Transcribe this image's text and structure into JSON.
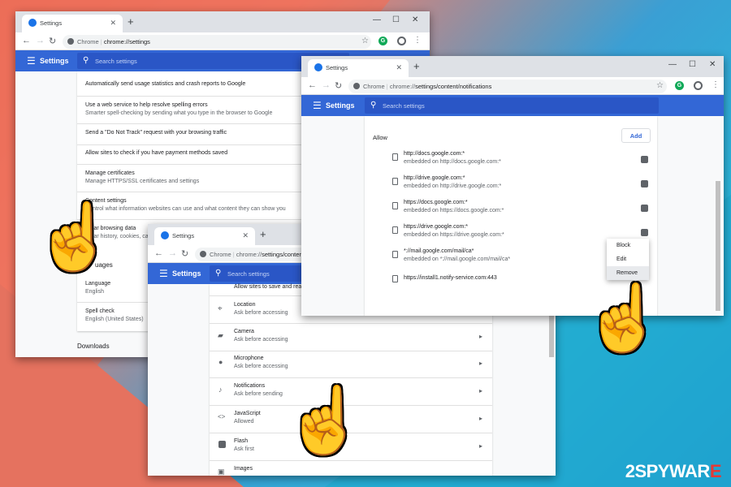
{
  "colors": {
    "accent": "#3367d6",
    "header": "#3367d6",
    "search": "#2a56c6",
    "chrome_green": "#0fa958"
  },
  "win1": {
    "tab_title": "Settings",
    "omni_scheme": "Chrome",
    "omni_path": "chrome://settings",
    "header_title": "Settings",
    "search_placeholder": "Search settings",
    "rows": [
      {
        "title": "Automatically send usage statistics and crash reports to Google",
        "sub": ""
      },
      {
        "title": "Use a web service to help resolve spelling errors",
        "sub": "Smarter spell-checking by sending what you type in the browser to Google"
      },
      {
        "title": "Send a \"Do Not Track\" request with your browsing traffic",
        "sub": ""
      },
      {
        "title": "Allow sites to check if you have payment methods saved",
        "sub": ""
      },
      {
        "title": "Manage certificates",
        "sub": "Manage HTTPS/SSL certificates and settings"
      },
      {
        "title": "Content settings",
        "sub": "Control what information websites can use and what content they can show you"
      },
      {
        "title": "Clear browsing data",
        "sub": "Clear history, cookies, cac"
      }
    ],
    "languages_heading": "uages",
    "language_title": "Language",
    "language_value": "English",
    "spell_title": "Spell check",
    "spell_value": "English (United States)",
    "downloads_heading": "Downloads"
  },
  "win2": {
    "tab_title": "Settings",
    "omni_scheme": "Chrome",
    "omni_path_prefix": "chrome://",
    "omni_path": "settings/content",
    "header_title": "Settings",
    "search_placeholder": "Search settings",
    "top_partial": "Allow sites to save and read",
    "items": [
      {
        "icon": "location-icon",
        "title": "Location",
        "sub": "Ask before accessing"
      },
      {
        "icon": "camera-icon",
        "title": "Camera",
        "sub": "Ask before accessing"
      },
      {
        "icon": "microphone-icon",
        "title": "Microphone",
        "sub": "Ask before accessing"
      },
      {
        "icon": "bell-icon",
        "title": "Notifications",
        "sub": "Ask before sending"
      },
      {
        "icon": "code-icon",
        "title": "JavaScript",
        "sub": "Allowed"
      },
      {
        "icon": "puzzle-icon",
        "title": "Flash",
        "sub": "Ask first"
      },
      {
        "icon": "image-icon",
        "title": "Images",
        "sub": ""
      }
    ]
  },
  "win3": {
    "tab_title": "Settings",
    "omni_scheme": "Chrome",
    "omni_path_prefix": "chrome://",
    "omni_path": "settings/content/notifications",
    "header_title": "Settings",
    "search_placeholder": "Search settings",
    "allow_label": "Allow",
    "add_button": "Add",
    "sites": [
      {
        "url": "http://docs.google.com:*",
        "sub": "embedded on http://docs.google.com:*"
      },
      {
        "url": "http://drive.google.com:*",
        "sub": "embedded on http://drive.google.com:*"
      },
      {
        "url": "https://docs.google.com:*",
        "sub": "embedded on https://docs.google.com:*"
      },
      {
        "url": "https://drive.google.com:*",
        "sub": "embedded on https://drive.google.com:*"
      },
      {
        "url": "*://mail.google.com/mail/ca*",
        "sub": "embedded on *://mail.google.com/mail/ca*"
      },
      {
        "url": "https://install1.notify-service.com:443",
        "sub": ""
      }
    ],
    "context_menu": [
      "Block",
      "Edit",
      "Remove"
    ]
  },
  "watermark": {
    "part1": "2",
    "part2": "SPYWAR",
    "part3": "E"
  }
}
